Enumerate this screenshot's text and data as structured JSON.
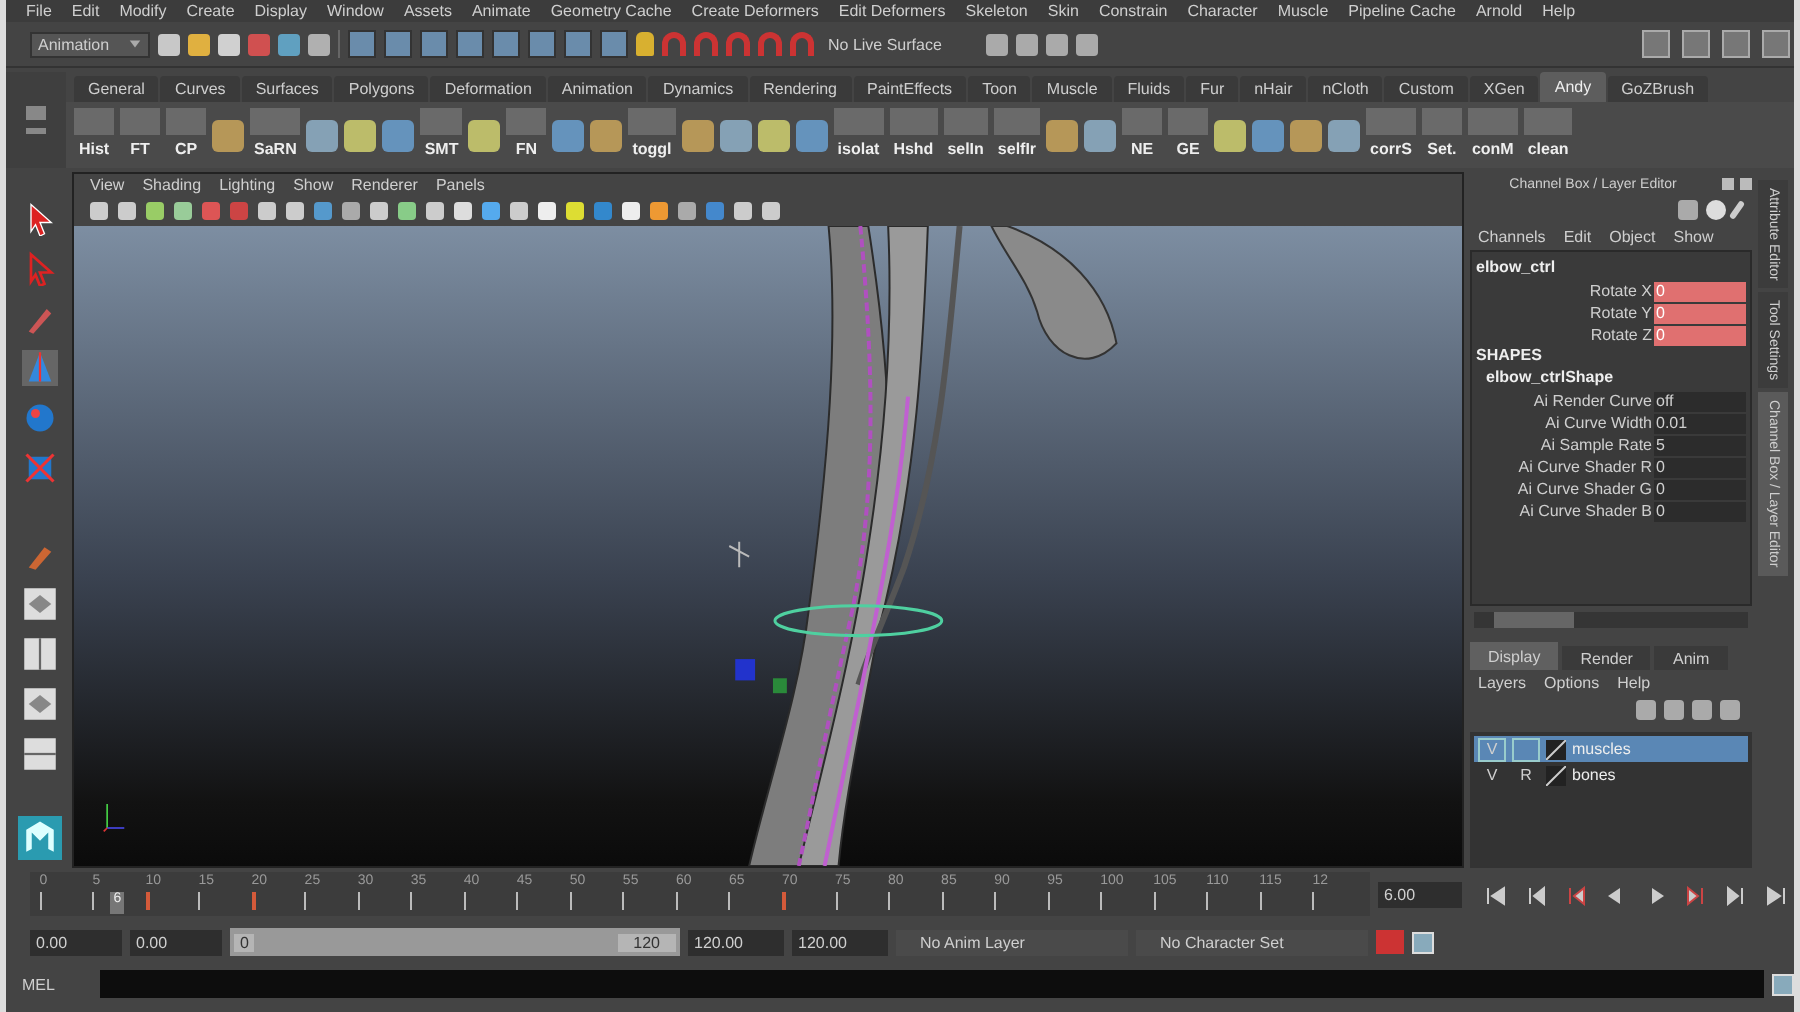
{
  "menu_bar": [
    "File",
    "Edit",
    "Modify",
    "Create",
    "Display",
    "Window",
    "Assets",
    "Animate",
    "Geometry Cache",
    "Create Deformers",
    "Edit Deformers",
    "Skeleton",
    "Skin",
    "Constrain",
    "Character",
    "Muscle",
    "Pipeline Cache",
    "Arnold",
    "Help"
  ],
  "status_line": {
    "mode": "Animation",
    "live_surface": "No Live Surface"
  },
  "shelf": {
    "tabs": [
      {
        "label": "General",
        "selected": false
      },
      {
        "label": "Curves",
        "selected": false
      },
      {
        "label": "Surfaces",
        "selected": false
      },
      {
        "label": "Polygons",
        "selected": false
      },
      {
        "label": "Deformation",
        "selected": false
      },
      {
        "label": "Animation",
        "selected": false
      },
      {
        "label": "Dynamics",
        "selected": false
      },
      {
        "label": "Rendering",
        "selected": false
      },
      {
        "label": "PaintEffects",
        "selected": false
      },
      {
        "label": "Toon",
        "selected": false
      },
      {
        "label": "Muscle",
        "selected": false
      },
      {
        "label": "Fluids",
        "selected": false
      },
      {
        "label": "Fur",
        "selected": false
      },
      {
        "label": "nHair",
        "selected": false
      },
      {
        "label": "nCloth",
        "selected": false
      },
      {
        "label": "Custom",
        "selected": false
      },
      {
        "label": "XGen",
        "selected": false
      },
      {
        "label": "Andy",
        "selected": true
      },
      {
        "label": "GoZBrush",
        "selected": false
      }
    ],
    "buttons": [
      "Hist",
      "FT",
      "CP",
      "SaRN",
      "SMT",
      "FN",
      "toggl",
      "isolat",
      "Hshd",
      "selIn",
      "selfIr",
      "NE",
      "GE",
      "corrS",
      "Set.",
      "conM",
      "clean"
    ]
  },
  "viewport": {
    "menu": [
      "View",
      "Shading",
      "Lighting",
      "Show",
      "Renderer",
      "Panels"
    ]
  },
  "channel_box": {
    "title": "Channel Box / Layer Editor",
    "menu": [
      "Channels",
      "Edit",
      "Object",
      "Show"
    ],
    "node": "elbow_ctrl",
    "attributes": [
      {
        "name": "Rotate X",
        "value": "0",
        "keyed": true
      },
      {
        "name": "Rotate Y",
        "value": "0",
        "keyed": true
      },
      {
        "name": "Rotate Z",
        "value": "0",
        "keyed": true
      }
    ],
    "shapes_heading": "SHAPES",
    "shape_node": "elbow_ctrlShape",
    "shape_attributes": [
      {
        "name": "Ai Render Curve",
        "value": "off",
        "keyed": false
      },
      {
        "name": "Ai Curve Width",
        "value": "0.01",
        "keyed": false
      },
      {
        "name": "Ai Sample Rate",
        "value": "5",
        "keyed": false
      },
      {
        "name": "Ai Curve Shader R",
        "value": "0",
        "keyed": false
      },
      {
        "name": "Ai Curve Shader G",
        "value": "0",
        "keyed": false
      },
      {
        "name": "Ai Curve Shader B",
        "value": "0",
        "keyed": false
      }
    ]
  },
  "layer_editor": {
    "tabs": [
      {
        "label": "Display",
        "selected": true
      },
      {
        "label": "Render",
        "selected": false
      },
      {
        "label": "Anim",
        "selected": false
      }
    ],
    "menu": [
      "Layers",
      "Options",
      "Help"
    ],
    "layers": [
      {
        "name": "muscles",
        "flags": [
          "V"
        ],
        "selected": true
      },
      {
        "name": "bones",
        "flags": [
          "V",
          "R"
        ],
        "selected": false
      }
    ]
  },
  "side_tabs": [
    {
      "label": "Attribute Editor",
      "selected": false
    },
    {
      "label": "Tool Settings",
      "selected": false
    },
    {
      "label": "Channel Box / Layer Editor",
      "selected": true
    }
  ],
  "time_slider": {
    "ticks": [
      {
        "label": "0",
        "key": false
      },
      {
        "label": "5",
        "key": false
      },
      {
        "label": "10",
        "key": true
      },
      {
        "label": "15",
        "key": false
      },
      {
        "label": "20",
        "key": true
      },
      {
        "label": "25",
        "key": false
      },
      {
        "label": "30",
        "key": false
      },
      {
        "label": "35",
        "key": false
      },
      {
        "label": "40",
        "key": false
      },
      {
        "label": "45",
        "key": false
      },
      {
        "label": "50",
        "key": false
      },
      {
        "label": "55",
        "key": false
      },
      {
        "label": "60",
        "key": false
      },
      {
        "label": "65",
        "key": false
      },
      {
        "label": "70",
        "key": true
      },
      {
        "label": "75",
        "key": false
      },
      {
        "label": "80",
        "key": false
      },
      {
        "label": "85",
        "key": false
      },
      {
        "label": "90",
        "key": false
      },
      {
        "label": "95",
        "key": false
      },
      {
        "label": "100",
        "key": false
      },
      {
        "label": "105",
        "key": false
      },
      {
        "label": "110",
        "key": false
      },
      {
        "label": "115",
        "key": false
      },
      {
        "label": "12",
        "key": false
      }
    ],
    "current_frame": "6",
    "time_field": "6.00"
  },
  "range_slider": {
    "level": 1,
    "start": "0.00",
    "inner_start": "0.00",
    "handle_start": "0",
    "handle_end": "120",
    "inner_end": "120.00",
    "end": "120.00"
  },
  "anim_layer": "No Anim Layer",
  "character_set": "No Character Set",
  "command_line": {
    "label": "MEL"
  }
}
